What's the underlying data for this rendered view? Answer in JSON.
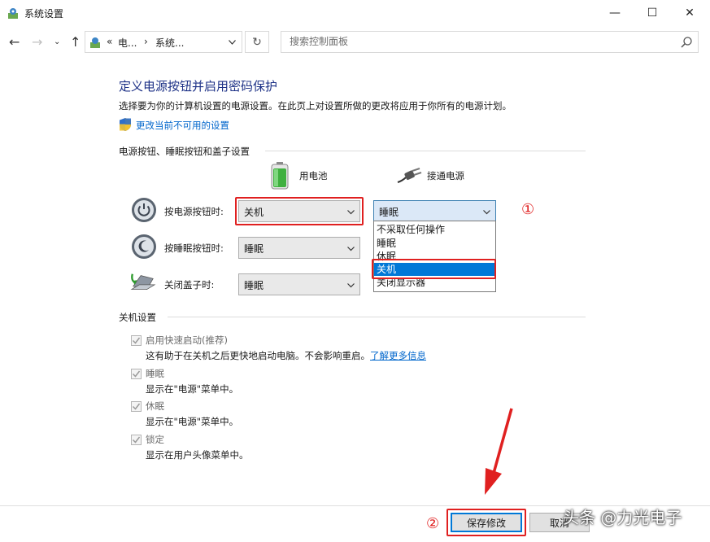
{
  "window": {
    "title": "系统设置",
    "minimize": "—",
    "maximize": "☐",
    "close": "✕"
  },
  "address": {
    "crumb_prefix": "«",
    "crumb1": "电...",
    "crumb_sep": "›",
    "crumb2": "系统...",
    "search_placeholder": "搜索控制面板"
  },
  "page": {
    "title": "定义电源按钮并启用密码保护",
    "description": "选择要为你的计算机设置的电源设置。在此页上对设置所做的更改将应用于你所有的电源计划。",
    "change_link": "更改当前不可用的设置"
  },
  "buttons_section": {
    "heading": "电源按钮、睡眠按钮和盖子设置",
    "col_battery": "用电池",
    "col_plugged": "接通电源",
    "rows": [
      {
        "label": "按电源按钮时:",
        "battery": "关机",
        "plugged": "睡眠"
      },
      {
        "label": "按睡眠按钮时:",
        "battery": "睡眠"
      },
      {
        "label": "关闭盖子时:",
        "battery": "睡眠"
      }
    ],
    "dropdown_options": [
      "不采取任何操作",
      "睡眠",
      "休眠",
      "关机",
      "关闭显示器"
    ],
    "selected_option": "关机"
  },
  "annotations": {
    "circle1": "①",
    "circle2": "②"
  },
  "shutdown_section": {
    "heading": "关机设置",
    "items": [
      {
        "label": "启用快速启动(推荐)",
        "desc": "这有助于在关机之后更快地启动电脑。不会影响重启。",
        "link": "了解更多信息"
      },
      {
        "label": "睡眠",
        "desc": "显示在\"电源\"菜单中。"
      },
      {
        "label": "休眠",
        "desc": "显示在\"电源\"菜单中。"
      },
      {
        "label": "锁定",
        "desc": "显示在用户头像菜单中。"
      }
    ]
  },
  "footer": {
    "save": "保存修改",
    "cancel": "取消"
  },
  "watermark": "头条 @力光电子",
  "colors": {
    "title_blue": "#1e3287",
    "link_blue": "#0066cc",
    "highlight_red": "#e02020",
    "select_blue": "#0078d7"
  }
}
